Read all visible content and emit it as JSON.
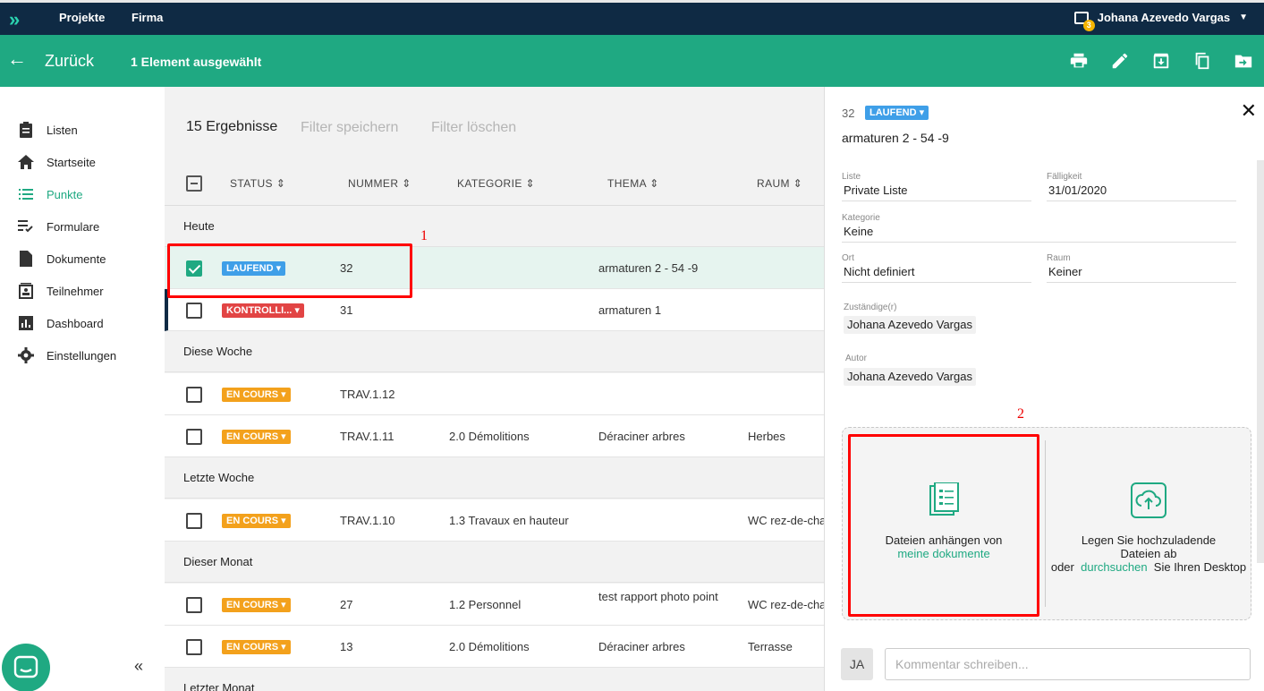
{
  "topnav": {
    "logo": "»",
    "links": [
      "Projekte",
      "Firma"
    ],
    "notification_count": "3",
    "user_name": "Johana Azevedo Vargas"
  },
  "actionbar": {
    "back_label": "Zurück",
    "selected_info": "1 Element ausgewählt",
    "icons": [
      "print-icon",
      "edit-icon",
      "archive-icon",
      "copy-icon",
      "move-folder-icon"
    ]
  },
  "sidebar": {
    "items": [
      {
        "label": "Listen",
        "icon": "clipboard-icon"
      },
      {
        "label": "Startseite",
        "icon": "home-icon"
      },
      {
        "label": "Punkte",
        "icon": "list-icon",
        "active": true
      },
      {
        "label": "Formulare",
        "icon": "checklist-icon"
      },
      {
        "label": "Dokumente",
        "icon": "document-icon"
      },
      {
        "label": "Teilnehmer",
        "icon": "contacts-icon"
      },
      {
        "label": "Dashboard",
        "icon": "chart-icon"
      },
      {
        "label": "Einstellungen",
        "icon": "gear-icon"
      }
    ],
    "collapse": "«"
  },
  "main": {
    "results": "15 Ergebnisse",
    "filter_save": "Filter speichern",
    "filter_clear": "Filter löschen",
    "columns": [
      "STATUS",
      "NUMMER",
      "KATEGORIE",
      "THEMA",
      "RAUM"
    ],
    "groups": [
      "Heute",
      "Diese Woche",
      "Letzte Woche",
      "Dieser Monat",
      "Letzter Monat"
    ],
    "rows": [
      {
        "status": "LAUFEND",
        "number": "32",
        "category": "",
        "topic": "armaturen 2 - 54 -9",
        "room": ""
      },
      {
        "status": "KONTROLLI...",
        "number": "31",
        "category": "",
        "topic": "armaturen 1",
        "room": ""
      },
      {
        "status": "EN COURS",
        "number": "TRAV.1.12",
        "category": "",
        "topic": "",
        "room": ""
      },
      {
        "status": "EN COURS",
        "number": "TRAV.1.11",
        "category": "2.0 Démolitions",
        "topic": "Déraciner arbres",
        "room": "Herbes"
      },
      {
        "status": "EN COURS",
        "number": "TRAV.1.10",
        "category": "1.3 Travaux en hauteur",
        "topic": "",
        "room": "WC rez-de-cha"
      },
      {
        "status": "EN COURS",
        "number": "27",
        "category": "1.2 Personnel",
        "topic": "test rapport photo point",
        "room": "WC rez-de-cha"
      },
      {
        "status": "EN COURS",
        "number": "13",
        "category": "2.0 Démolitions",
        "topic": "Déraciner arbres",
        "room": "Terrasse"
      }
    ]
  },
  "detail": {
    "number": "32",
    "status": "LAUFEND",
    "title": "armaturen 2 - 54 -9",
    "fields": {
      "liste_label": "Liste",
      "liste": "Private Liste",
      "faellig_label": "Fälligkeit",
      "faellig": "31/01/2020",
      "kategorie_label": "Kategorie",
      "kategorie": "Keine",
      "ort_label": "Ort",
      "ort": "Nicht definiert",
      "raum_label": "Raum",
      "raum": "Keiner",
      "zustaendig_label": "Zuständige(r)",
      "zustaendig": "Johana Azevedo Vargas",
      "autor_label": "Autor",
      "autor": "Johana Azevedo Vargas"
    },
    "attach": {
      "left_text": "Dateien anhängen von",
      "left_link": "meine dokumente",
      "right_text": "Legen Sie hochzuladende Dateien ab",
      "right_or": "oder",
      "right_link": "durchsuchen",
      "right_tail": "Sie Ihren Desktop"
    },
    "avatar": "JA",
    "comment_placeholder": "Kommentar schreiben..."
  },
  "annotations": [
    "1",
    "2"
  ],
  "colors": {
    "green": "#1fa982",
    "navy": "#0f2a44",
    "blue": "#3f9fe8",
    "red": "#e24444",
    "orange": "#f3a11c"
  }
}
